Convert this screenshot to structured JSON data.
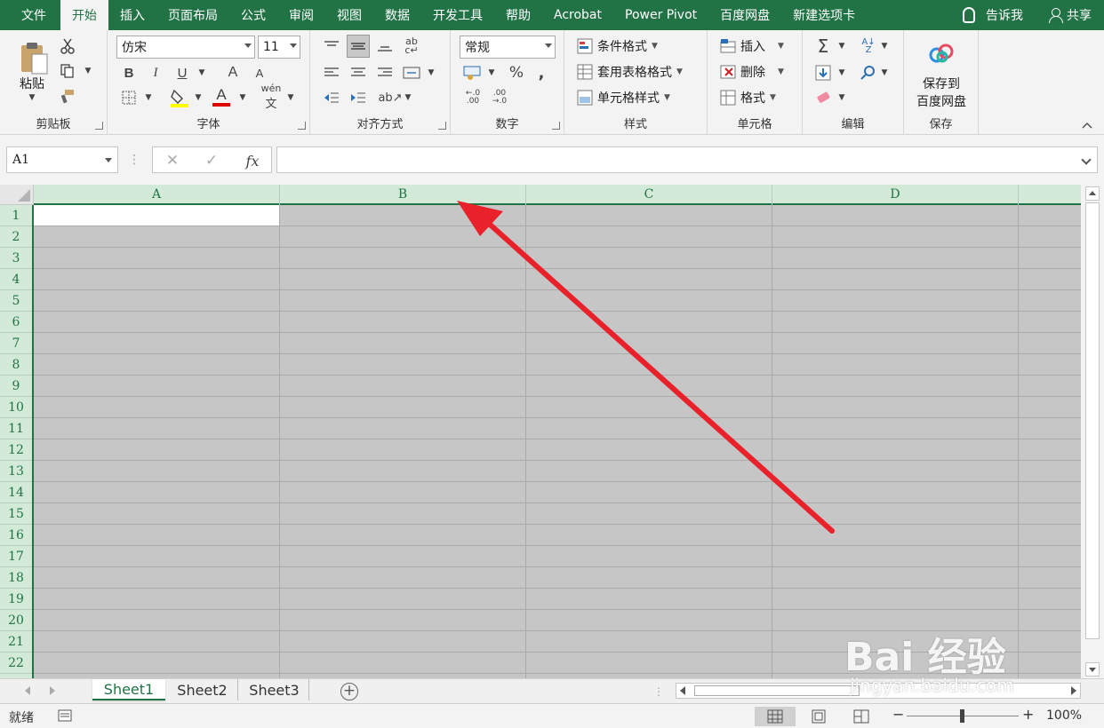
{
  "menubar": {
    "tabs": [
      {
        "label": "文件",
        "active": false
      },
      {
        "label": "开始",
        "active": true
      },
      {
        "label": "插入",
        "active": false
      },
      {
        "label": "页面布局",
        "active": false
      },
      {
        "label": "公式",
        "active": false
      },
      {
        "label": "审阅",
        "active": false
      },
      {
        "label": "视图",
        "active": false
      },
      {
        "label": "数据",
        "active": false
      },
      {
        "label": "开发工具",
        "active": false
      },
      {
        "label": "帮助",
        "active": false
      },
      {
        "label": "Acrobat",
        "active": false
      },
      {
        "label": "Power Pivot",
        "active": false
      },
      {
        "label": "百度网盘",
        "active": false
      },
      {
        "label": "新建选项卡",
        "active": false
      }
    ],
    "tell_me": "告诉我",
    "share": "共享"
  },
  "ribbon": {
    "clipboard": {
      "paste": "粘贴",
      "label": "剪贴板"
    },
    "font": {
      "font_name": "仿宋",
      "font_size": "11",
      "bold": "B",
      "italic": "I",
      "underline": "U",
      "grow": "A",
      "shrink": "A",
      "font_color_glyph": "A",
      "phonetic": "wén",
      "label": "字体"
    },
    "alignment": {
      "label": "对齐方式"
    },
    "number": {
      "format": "常规",
      "percent": "%",
      "comma": ",",
      "inc_decimal": ".0→.00",
      "dec_decimal": ".00→.0",
      "label": "数字"
    },
    "styles": {
      "conditional": "条件格式",
      "table_format": "套用表格格式",
      "cell_styles": "单元格样式",
      "label": "样式"
    },
    "cells": {
      "insert": "插入",
      "delete": "删除",
      "format": "格式",
      "label": "单元格"
    },
    "editing": {
      "label": "编辑"
    },
    "save": {
      "line1": "保存到",
      "line2": "百度网盘",
      "label": "保存"
    }
  },
  "formula_bar": {
    "name_box": "A1",
    "cancel": "✕",
    "enter": "✓",
    "fx": "fx",
    "value": ""
  },
  "columns": [
    "A",
    "B",
    "C",
    "D"
  ],
  "rows": [
    "1",
    "2",
    "3",
    "4",
    "5",
    "6",
    "7",
    "8",
    "9",
    "10",
    "11",
    "12",
    "13",
    "14",
    "15",
    "16",
    "17",
    "18",
    "19",
    "20",
    "21",
    "22"
  ],
  "sheets": [
    {
      "label": "Sheet1",
      "active": true
    },
    {
      "label": "Sheet2",
      "active": false
    },
    {
      "label": "Sheet3",
      "active": false
    }
  ],
  "status": {
    "ready": "就绪",
    "zoom": "100%",
    "zoom_minus": "−",
    "zoom_plus": "+"
  },
  "watermark": {
    "brand": "Bai 经验",
    "url": "jingyan.baidu.com"
  },
  "colors": {
    "excel_green": "#217346",
    "header_fill": "#d3ead9",
    "selection_fill": "#c6c6c6",
    "arrow": "#e8212a"
  }
}
